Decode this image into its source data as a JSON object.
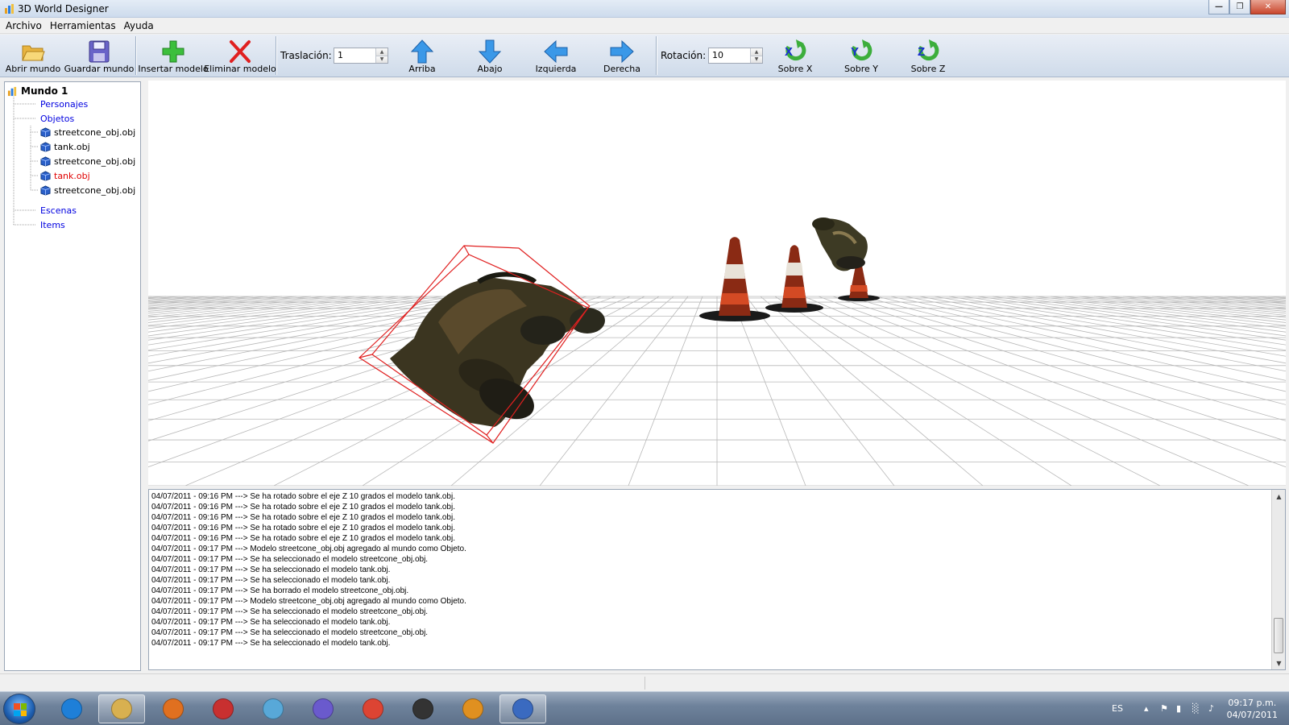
{
  "window": {
    "title": "3D World Designer"
  },
  "menu": [
    "Archivo",
    "Herramientas",
    "Ayuda"
  ],
  "toolbar": {
    "open_world": "Abrir mundo",
    "save_world": "Guardar mundo",
    "insert_model": "Insertar modelo",
    "delete_model": "Eliminar modelo",
    "translation_label": "Traslación:",
    "translation_value": "1",
    "up": "Arriba",
    "down": "Abajo",
    "left": "Izquierda",
    "right": "Derecha",
    "rotation_label": "Rotación:",
    "rotation_value": "10",
    "about_x": "Sobre X",
    "about_y": "Sobre Y",
    "about_z": "Sobre Z",
    "about_x_icon": "X",
    "about_y_icon": "Y",
    "about_z_icon": "Z"
  },
  "tree": {
    "root": "Mundo 1",
    "characters": "Personajes",
    "objects": "Objetos",
    "object_items": [
      "streetcone_obj.obj",
      "tank.obj",
      "streetcone_obj.obj",
      "tank.obj",
      "streetcone_obj.obj"
    ],
    "selected_index": 3,
    "scenes": "Escenas",
    "items": "Items"
  },
  "log": [
    "04/07/2011 - 09:16 PM ---> Se ha rotado sobre el eje Z 10 grados el modelo tank.obj.",
    "04/07/2011 - 09:16 PM ---> Se ha rotado sobre el eje Z 10 grados el modelo tank.obj.",
    "04/07/2011 - 09:16 PM ---> Se ha rotado sobre el eje Z 10 grados el modelo tank.obj.",
    "04/07/2011 - 09:16 PM ---> Se ha rotado sobre el eje Z 10 grados el modelo tank.obj.",
    "04/07/2011 - 09:16 PM ---> Se ha rotado sobre el eje Z 10 grados el modelo tank.obj.",
    "04/07/2011 - 09:17 PM ---> Modelo streetcone_obj.obj agregado al mundo como Objeto.",
    "04/07/2011 - 09:17 PM ---> Se ha seleccionado el modelo streetcone_obj.obj.",
    "04/07/2011 - 09:17 PM ---> Se ha seleccionado el modelo tank.obj.",
    "04/07/2011 - 09:17 PM ---> Se ha seleccionado el modelo tank.obj.",
    "04/07/2011 - 09:17 PM ---> Se ha borrado el modelo streetcone_obj.obj.",
    "04/07/2011 - 09:17 PM ---> Modelo streetcone_obj.obj agregado al mundo como Objeto.",
    "04/07/2011 - 09:17 PM ---> Se ha seleccionado el modelo streetcone_obj.obj.",
    "04/07/2011 - 09:17 PM ---> Se ha seleccionado el modelo tank.obj.",
    "04/07/2011 - 09:17 PM ---> Se ha seleccionado el modelo streetcone_obj.obj.",
    "04/07/2011 - 09:17 PM ---> Se ha seleccionado el modelo tank.obj."
  ],
  "taskbar": {
    "language": "ES",
    "time": "09:17 p.m.",
    "date": "04/07/2011",
    "icons": [
      "internet-explorer-icon",
      "file-explorer-icon",
      "media-player-icon",
      "flash-icon",
      "messenger-icon",
      "visual-studio-icon",
      "chrome-icon",
      "paint-app-icon",
      "designer-app-icon",
      "visual-studio-designer-icon"
    ]
  },
  "colors": {
    "selected_item": "#e00000",
    "category_link": "#0000e0",
    "selection_box": "#e02020"
  }
}
